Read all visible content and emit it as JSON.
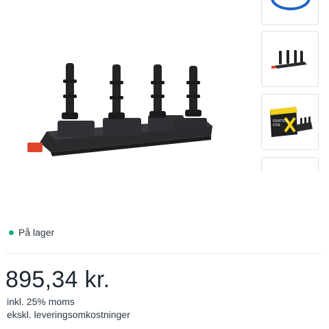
{
  "product": {
    "main_image_icon": "ignition-coil-pack-image",
    "thumbnails": [
      {
        "name": "brand-logo-thumbnail",
        "icon": "brand-logo-icon"
      },
      {
        "name": "ignition-coil-thumbnail",
        "icon": "ignition-coil-icon"
      },
      {
        "name": "ignition-coil-box-thumbnail",
        "icon": "ignition-coil-packaging-icon",
        "box_text_line1": "IGNITION",
        "box_text_line2": "COIL"
      },
      {
        "name": "more-thumbnail",
        "icon": "thumbnail-icon"
      }
    ]
  },
  "stock": {
    "label": "På lager",
    "status_color": "#1aa883"
  },
  "pricing": {
    "price": "895,34 kr.",
    "vat_note": "inkl. 25% moms",
    "delivery_note": "ekskl. leveringsomkostninger"
  },
  "colors": {
    "accent_blue": "#1c64c4",
    "packaging_yellow": "#f2d21b",
    "connector_red": "#e0452b"
  }
}
